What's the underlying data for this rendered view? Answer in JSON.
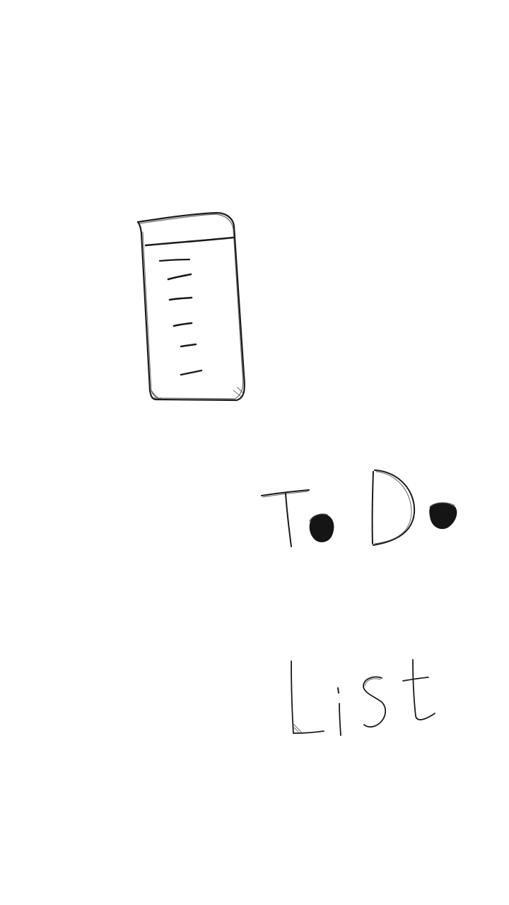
{
  "splash": {
    "app_icon": "notepad-sketch-icon",
    "title_line_1": "ToDo",
    "title_line_2": "List",
    "stroke_color": "#1a1a1a",
    "background_color": "#ffffff"
  }
}
